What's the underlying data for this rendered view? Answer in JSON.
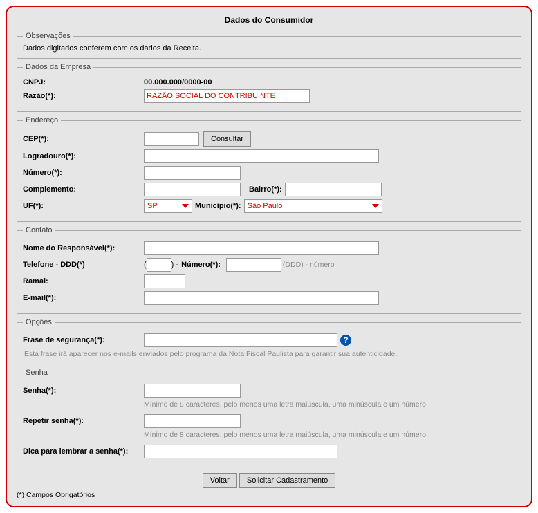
{
  "page_title": "Dados do Consumidor",
  "observacoes": {
    "legend": "Observações",
    "text": "Dados digitados conferem com os dados da Receita."
  },
  "empresa": {
    "legend": "Dados da Empresa",
    "cnpj_label": "CNPJ:",
    "cnpj_value": "00.000.000/0000-00",
    "razao_label": "Razão(*):",
    "razao_value": "RAZÃO SOCIAL DO CONTRIBUINTE"
  },
  "endereco": {
    "legend": "Endereço",
    "cep_label": "CEP(*):",
    "cep_value": "",
    "consultar": "Consultar",
    "logradouro_label": "Logradouro(*):",
    "logradouro_value": "",
    "numero_label": "Número(*):",
    "numero_value": "",
    "complemento_label": "Complemento:",
    "complemento_value": "",
    "bairro_label": "Bairro(*):",
    "bairro_value": "",
    "uf_label": "UF(*):",
    "uf_value": "SP",
    "municipio_label": "Município(*):",
    "municipio_value": "São Paulo"
  },
  "contato": {
    "legend": "Contato",
    "resp_label": "Nome do Responsável(*):",
    "resp_value": "",
    "tel_label": "Telefone - DDD(*)",
    "ddd_value": "",
    "tel_num_label": "Número(*):",
    "tel_num_value": "",
    "tel_hint": "(DDD) - número",
    "ramal_label": "Ramal:",
    "ramal_value": "",
    "email_label": "E-mail(*):",
    "email_value": ""
  },
  "opcoes": {
    "legend": "Opções",
    "frase_label": "Frase de segurança(*):",
    "frase_value": "",
    "frase_hint": "Esta frase irá aparecer nos e-mails enviados pelo programa da Nota Fiscal Paulista para garantir sua autenticidade."
  },
  "senha": {
    "legend": "Senha",
    "senha_label": "Senha(*):",
    "senha_value": "",
    "senha_hint": "Mínimo de 8 caracteres, pelo menos uma letra maiúscula, uma minúscula e um número",
    "repetir_label": "Repetir senha(*):",
    "repetir_value": "",
    "repetir_hint": "Mínimo de 8 caracteres, pelo menos uma letra maiúscula, uma minúscula e um número",
    "dica_label": "Dica para lembrar a senha(*):",
    "dica_value": ""
  },
  "actions": {
    "voltar": "Voltar",
    "solicitar": "Solicitar Cadastramento"
  },
  "footnote": "(*) Campos Obrigatórios",
  "help_char": "?"
}
